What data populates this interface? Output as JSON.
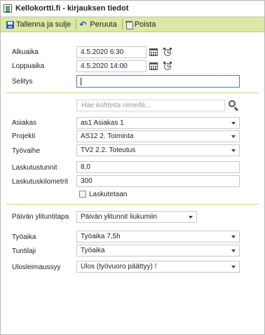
{
  "window": {
    "title": "Kellokortti.fi - kirjauksen tiedot"
  },
  "toolbar": {
    "save_label": "Tallenna ja sulje",
    "cancel_label": "Peruuta",
    "delete_label": "Poista"
  },
  "form": {
    "start": {
      "label": "Alkuaika",
      "value": "4.5.2020 6:30"
    },
    "end": {
      "label": "Loppuaika",
      "value": "4.5.2020 14:00"
    },
    "description": {
      "label": "Selitys",
      "value": ""
    },
    "search": {
      "placeholder": "Hae kohteita nimellä..."
    },
    "customer": {
      "label": "Asiakas",
      "value": "as1 Asiakas 1"
    },
    "project": {
      "label": "Projekti",
      "value": "AS12 2. Toiminta"
    },
    "phase": {
      "label": "Työvaihe",
      "value": "TV2 2.2. Toteutus"
    },
    "billable_hours": {
      "label": "Laskutustunnit",
      "value": "8,0"
    },
    "billable_km": {
      "label": "Laskutuskilometrit",
      "value": "300"
    },
    "billed": {
      "label": "Laskutetaan",
      "checked": false
    },
    "overtime_mode": {
      "label": "Päivän ylituntitapa",
      "value": "Päivän ylitunnit liukumiin"
    },
    "work_time": {
      "label": "Työaika",
      "value": "Työaika 7,5h"
    },
    "hour_type": {
      "label": "Tuntilaji",
      "value": "Työaika"
    },
    "clock_out": {
      "label": "Ulosleimaussyy",
      "value": "Ulos (työvuoro päättyy) !"
    }
  },
  "icons": {
    "app": "notepad-icon",
    "save": "floppy-disk-icon",
    "cancel": "undo-arrow-icon",
    "delete": "trash-icon",
    "calendar": "calendar-icon",
    "alarm": "alarm-clock-icon",
    "search": "magnifier-icon"
  },
  "colors": {
    "toolbar_bg": "#dce9a6",
    "divider": "#c9d77a",
    "focus_border": "#3b7fd0"
  }
}
